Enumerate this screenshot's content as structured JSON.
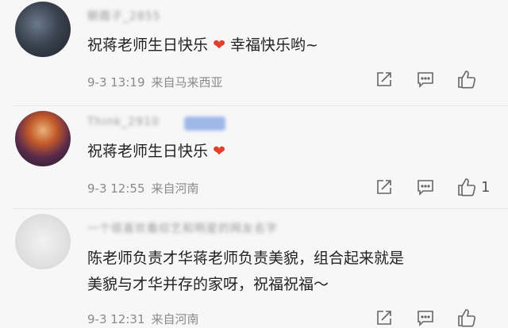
{
  "comments": [
    {
      "username": "朝霞子_2855",
      "text_before": "祝蒋老师生日快乐",
      "heart": "❤",
      "text_after": " 幸福快乐哟~",
      "time": "9-3 13:19",
      "location": "来自马来西亚",
      "likes": ""
    },
    {
      "username": "Think_2910",
      "text_before": "祝蒋老师生日快乐",
      "heart": "❤",
      "time": "9-3 12:55",
      "location": "来自河南",
      "likes": "1"
    },
    {
      "username": "一个很喜欢看综艺和明星的网友名字",
      "text_line1": "陈老师负责才华蒋老师负责美貌，组合起来就是",
      "text_line2": "美貌与才华并存的家呀，祝福祝福～",
      "time": "9-3 12:31",
      "location": "来自河南",
      "likes": ""
    }
  ],
  "icons": {
    "share": "share-icon",
    "comment": "comment-icon",
    "like": "thumbs-up-icon"
  },
  "colors": {
    "heart": "#e2402c",
    "meta": "#8a8a8a",
    "background": "#f7f7f7"
  }
}
